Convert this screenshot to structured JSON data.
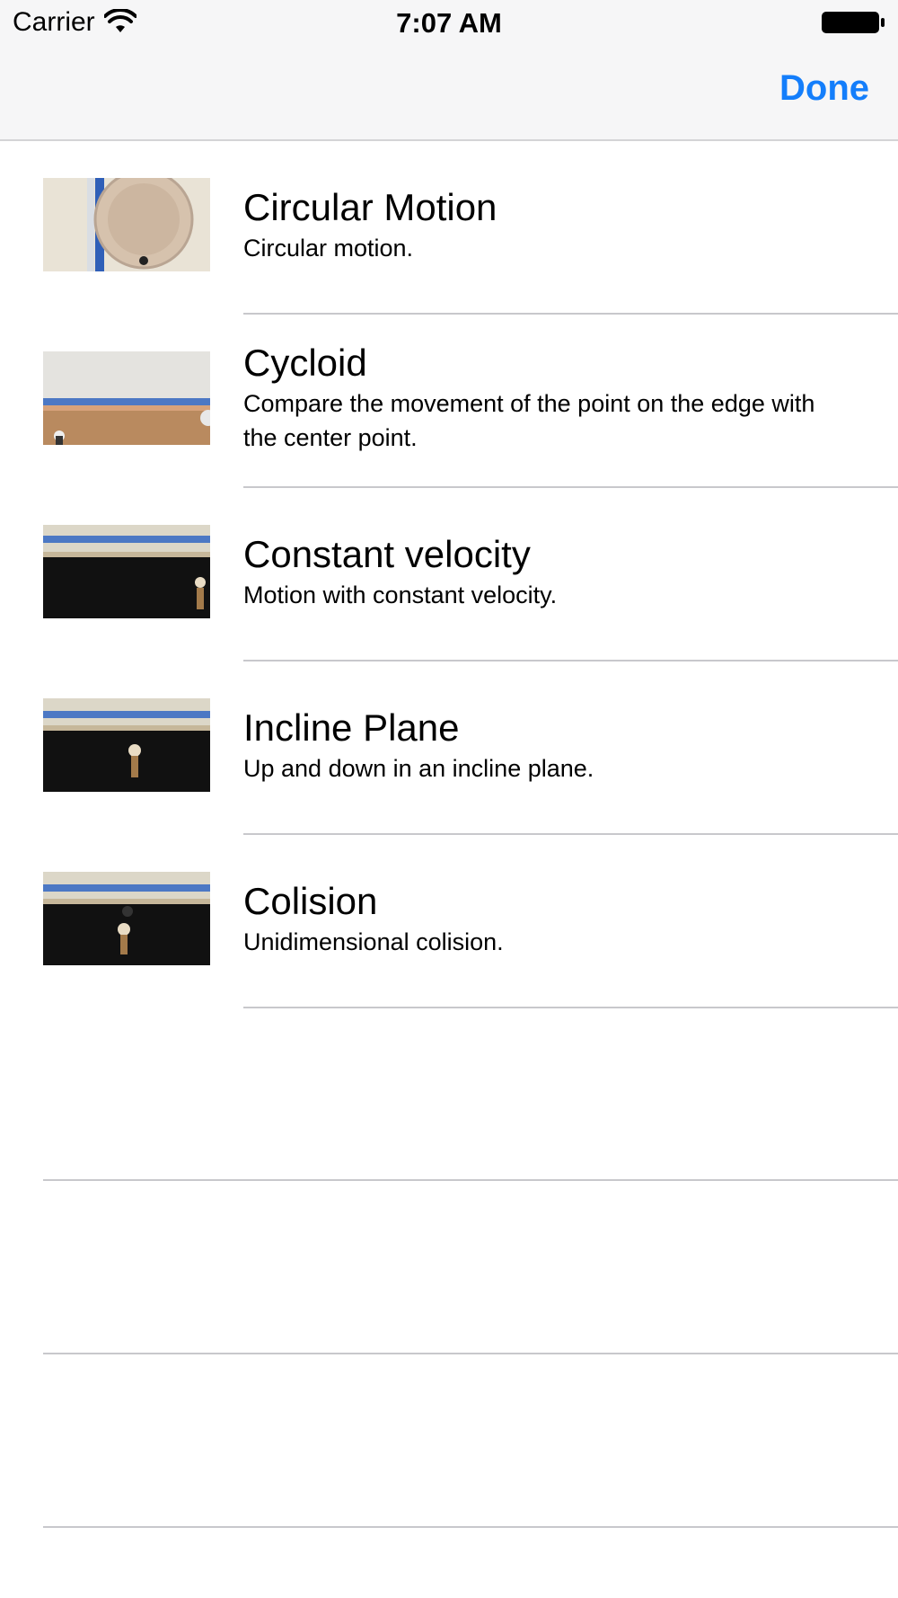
{
  "status_bar": {
    "carrier": "Carrier",
    "time": "7:07 AM"
  },
  "nav": {
    "done_label": "Done",
    "accent_color": "#147efb"
  },
  "experiments": [
    {
      "title": "Circular Motion",
      "subtitle": "Circular motion.",
      "thumbnail": "circular-plate-photo"
    },
    {
      "title": "Cycloid",
      "subtitle": "Compare the movement of the point on the edge with the center point.",
      "thumbnail": "cycloid-floor-photo"
    },
    {
      "title": "Constant velocity",
      "subtitle": "Motion with constant velocity.",
      "thumbnail": "constant-velocity-photo"
    },
    {
      "title": "Incline Plane",
      "subtitle": "Up and down in an incline plane.",
      "thumbnail": "incline-plane-photo"
    },
    {
      "title": "Colision",
      "subtitle": "Unidimensional colision.",
      "thumbnail": "colision-photo"
    }
  ]
}
